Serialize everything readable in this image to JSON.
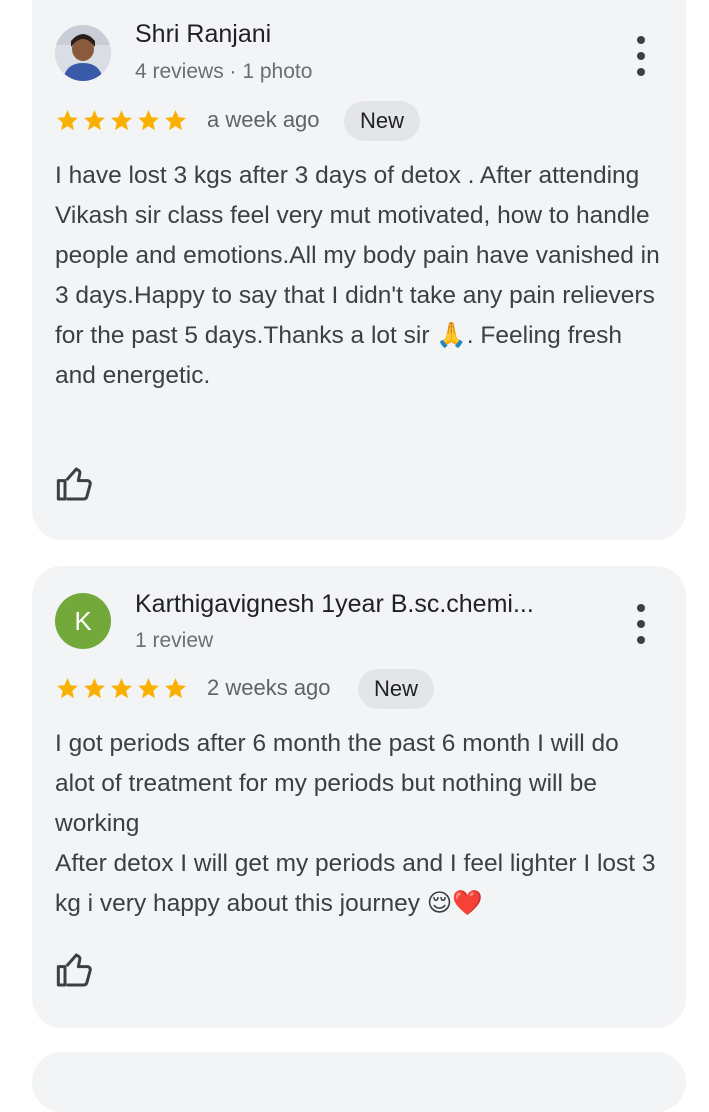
{
  "reviews": [
    {
      "name": "Shri Ranjani",
      "meta": "4 reviews · 1 photo",
      "rating": 5,
      "date": "a week ago",
      "badge": "New",
      "text": "I have lost 3 kgs after 3 days of detox . After attending Vikash sir class feel very mut motivated, how to handle people and emotions.All my body pain have vanished in 3 days.Happy to say that I didn't take any pain relievers for the past 5 days.Thanks a lot sir 🙏. Feeling fresh and energetic.",
      "avatar_type": "photo"
    },
    {
      "name": "Karthigavignesh 1year B.sc.chemi...",
      "meta": "1 review",
      "rating": 5,
      "date": "2 weeks ago",
      "badge": "New",
      "text_lines": [
        "I got periods after 6 month the past 6 month I will do alot of treatment for my periods but nothing will be working",
        "After detox I will get my periods and I feel lighter I lost 3 kg i very happy about this journey 😌❤️"
      ],
      "avatar_letter": "K",
      "avatar_color": "#73a93b"
    }
  ],
  "colors": {
    "star": "#f9b000",
    "card_bg": "#f3f4f6",
    "chip_bg": "#e3e5e8"
  },
  "icons": [
    "more-vert-icon",
    "star-icon",
    "thumb-up-icon"
  ]
}
